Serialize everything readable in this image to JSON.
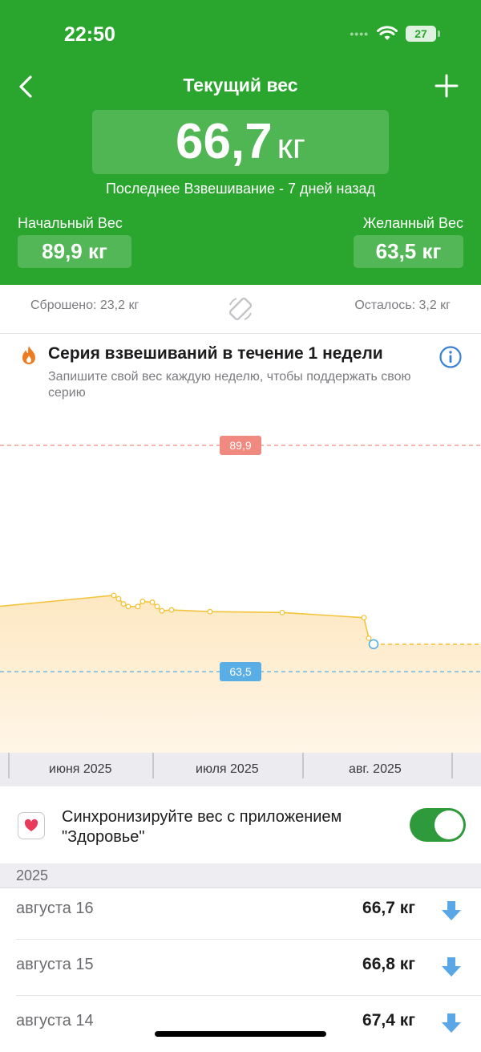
{
  "status": {
    "time": "22:50",
    "battery": "27"
  },
  "header": {
    "title": "Текущий вес",
    "current_value": "66,7",
    "current_unit": "кг",
    "last_weigh": "Последнее Взвешивание - 7 дней назад",
    "start_label": "Начальный Вес",
    "start_value": "89,9 кг",
    "goal_label": "Желанный Вес",
    "goal_value": "63,5 кг"
  },
  "summary": {
    "lost": "Сброшено: 23,2 кг",
    "remaining": "Осталось: 3,2 кг"
  },
  "streak": {
    "title": "Серия взвешиваний в течение 1 недели",
    "subtitle": "Запишите свой вес каждую неделю, чтобы поддержать свою серию"
  },
  "chart_data": {
    "type": "area",
    "reference_lines": [
      {
        "label": "89,9",
        "value": 89.9,
        "color": "#f08a80"
      },
      {
        "label": "63,5",
        "value": 63.5,
        "color": "#5aaee6"
      }
    ],
    "x_labels": [
      "июня 2025",
      "июля 2025",
      "авг. 2025"
    ],
    "x": [
      "2025-05-15",
      "2025-06-23",
      "2025-06-24",
      "2025-06-25",
      "2025-06-26",
      "2025-06-28",
      "2025-06-29",
      "2025-07-01",
      "2025-07-02",
      "2025-07-03",
      "2025-07-05",
      "2025-07-13",
      "2025-07-28",
      "2025-08-14",
      "2025-08-15",
      "2025-08-16"
    ],
    "values": [
      70.3,
      72.4,
      72.0,
      71.4,
      71.1,
      71.1,
      71.7,
      71.6,
      71.1,
      70.6,
      70.7,
      70.5,
      70.4,
      69.8,
      67.4,
      66.7
    ],
    "projection_to": 66.7,
    "series_color": "#f4c33c",
    "fill_color": "#fdeccc"
  },
  "sync": {
    "text": "Синхронизируйте вес с приложением \"Здоровье\"",
    "enabled": true
  },
  "log": {
    "year": "2025",
    "entries": [
      {
        "date": "августа 16",
        "value": "66,7 кг"
      },
      {
        "date": "августа 15",
        "value": "66,8 кг"
      },
      {
        "date": "августа 14",
        "value": "67,4 кг"
      }
    ]
  },
  "colors": {
    "header_green": "#2aa52e",
    "toggle_green": "#2f9a3b",
    "arrow_blue": "#5aa7e8",
    "streak_orange": "#f07a1e"
  }
}
